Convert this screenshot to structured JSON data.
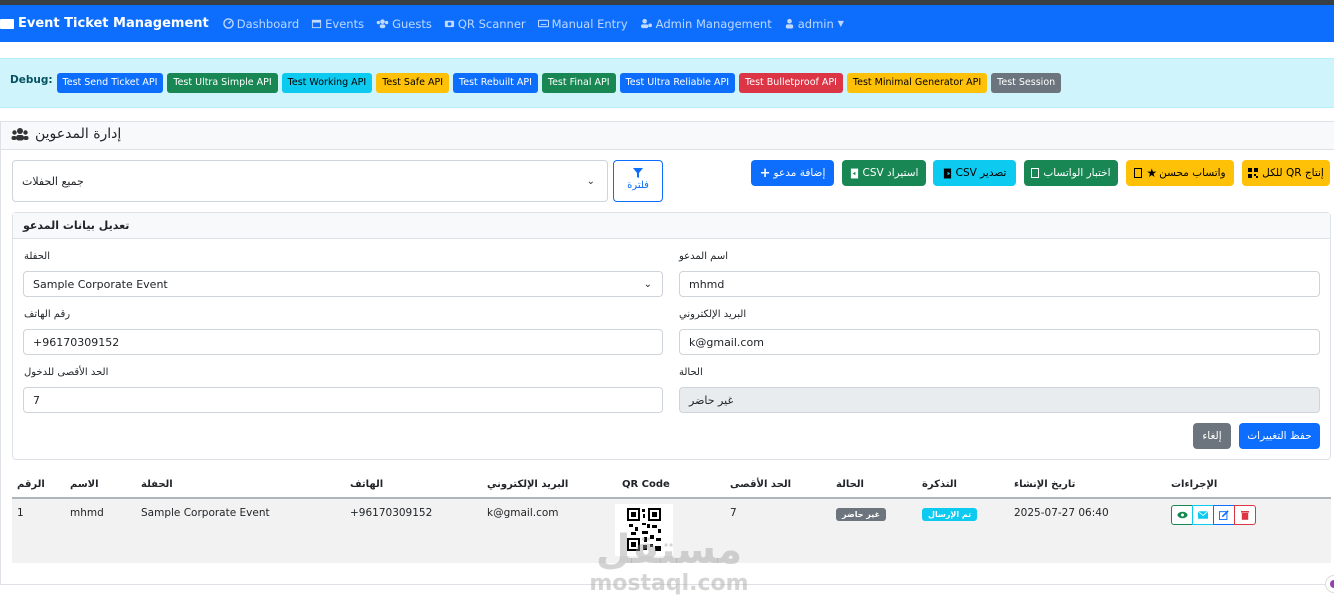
{
  "nav": {
    "brand": "Event Ticket Management",
    "items": [
      {
        "label": "Dashboard",
        "icon": "dashboard-icon"
      },
      {
        "label": "Events",
        "icon": "calendar-icon"
      },
      {
        "label": "Guests",
        "icon": "users-icon"
      },
      {
        "label": "QR Scanner",
        "icon": "camera-icon"
      },
      {
        "label": "Manual Entry",
        "icon": "keyboard-icon"
      },
      {
        "label": "Admin Management",
        "icon": "user-cog-icon"
      }
    ],
    "user": "admin"
  },
  "debug": {
    "label": "Debug:",
    "buttons": [
      {
        "label": "Test Send Ticket API",
        "color": "#0d6efd"
      },
      {
        "label": "Test Ultra Simple API",
        "color": "#198754"
      },
      {
        "label": "Test Working API",
        "color": "#0dcaf0"
      },
      {
        "label": "Test Safe API",
        "color": "#ffc107"
      },
      {
        "label": "Test Rebuilt API",
        "color": "#0d6efd"
      },
      {
        "label": "Test Final API",
        "color": "#198754"
      },
      {
        "label": "Test Ultra Reliable API",
        "color": "#0d6efd"
      },
      {
        "label": "Test Bulletproof API",
        "color": "#dc3545"
      },
      {
        "label": "Test Minimal Generator API",
        "color": "#ffc107"
      },
      {
        "label": "Test Session",
        "color": "#6c757d"
      }
    ]
  },
  "page": {
    "title": "إدارة المدعوين"
  },
  "toolbar": {
    "event_filter_value": "جميع الحفلات",
    "filter_button": "فلترة",
    "add_guest": "إضافة مدعو",
    "import_csv": "استيراد CSV",
    "export_csv": "تصدير CSV",
    "test_whatsapp": "اختبار الواتساب",
    "enhanced_whatsapp": "واتساب محسن",
    "generate_qr_all": "إنتاج QR للكل"
  },
  "edit_form": {
    "title": "تعديل بيانات المدعو",
    "event_label": "الحفلة",
    "event_value": "Sample Corporate Event",
    "name_label": "اسم المدعو",
    "name_value": "mhmd",
    "phone_label": "رقم الهاتف",
    "phone_value": "+96170309152",
    "email_label": "البريد الإلكتروني",
    "email_value": "k@gmail.com",
    "max_entry_label": "الحد الأقصى للدخول",
    "max_entry_value": "7",
    "status_label": "الحالة",
    "status_value": "غير حاضر",
    "save": "حفظ التغييرات",
    "cancel": "إلغاء"
  },
  "table": {
    "headers": {
      "num": "الرقم",
      "name": "الاسم",
      "event": "الحفلة",
      "phone": "الهاتف",
      "email": "البريد الإلكتروني",
      "qr": "QR Code",
      "max": "الحد الأقصى",
      "status": "الحالة",
      "ticket": "التذكرة",
      "created": "تاريخ الإنشاء",
      "actions": "الإجراءات"
    },
    "rows": [
      {
        "num": "1",
        "name": "mhmd",
        "event": "Sample Corporate Event",
        "phone": "+96170309152",
        "email": "k@gmail.com",
        "max": "7",
        "status": "غير حاضر",
        "status_color": "#6c757d",
        "ticket": "تم الإرسال",
        "ticket_color": "#0dcaf0",
        "created": "2025-07-27 06:40"
      }
    ]
  },
  "watermark": {
    "arabic": "مستقل",
    "latin": "mostaql.com"
  }
}
